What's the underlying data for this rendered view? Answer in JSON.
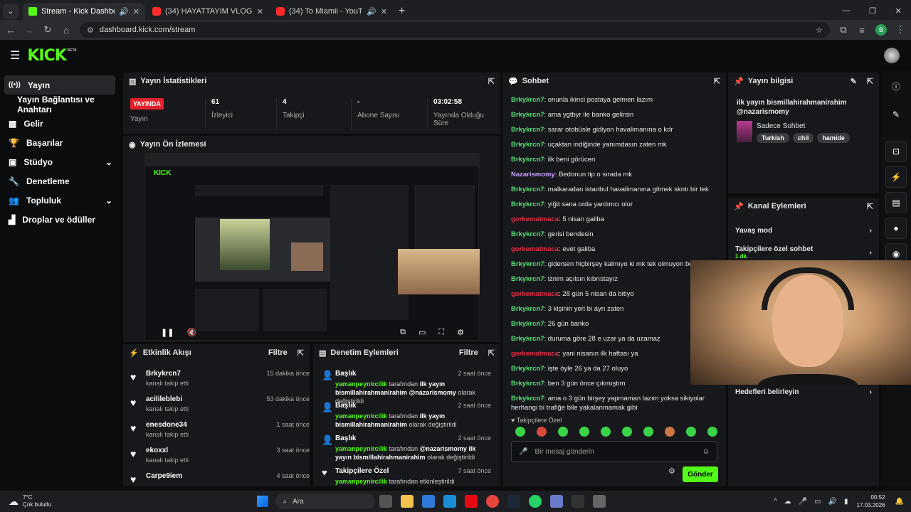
{
  "tabs": [
    {
      "title": "Stream - Kick Dashboard",
      "fav": "#53fc18"
    },
    {
      "title": "(34) HAYATTAYIM VLOG - YouTu",
      "fav": "#ff2a2a"
    },
    {
      "title": "(34) To Miamii - YouTube",
      "fav": "#ff2a2a"
    }
  ],
  "address": {
    "url": "dashboard.kick.com/stream",
    "profile": "B"
  },
  "brand": {
    "logo": "KICK",
    "beta": "BETA"
  },
  "sidebar": [
    {
      "label": "Yayın",
      "icon": "broadcast-icon"
    },
    {
      "label": "Yayın Bağlantısı ve Anahtarı",
      "icon": ""
    },
    {
      "label": "Gelir",
      "icon": "revenue-icon"
    },
    {
      "label": "Başarılar",
      "icon": "trophy-icon"
    },
    {
      "label": "Stüdyo",
      "icon": "studio-icon"
    },
    {
      "label": "Denetleme",
      "icon": "wrench-icon"
    },
    {
      "label": "Topluluk",
      "icon": "community-icon"
    },
    {
      "label": "Droplar ve ödüller",
      "icon": "drops-icon"
    }
  ],
  "stats": {
    "title": "Yayın İstatistikleri",
    "live": "YAYINDA",
    "status_label": "Yayın",
    "viewers": "61",
    "viewers_label": "İzleyici",
    "followers": "4",
    "followers_label": "Takipçi",
    "subs": "-",
    "subs_label": "Abone Sayısı",
    "duration": "03:02:58",
    "duration_label": "Yayında Olduğu Süre"
  },
  "preview": {
    "title": "Yayın Ön İzlemesi"
  },
  "activity": {
    "title": "Etkinlik Akışı",
    "filter": "Filtre",
    "items": [
      {
        "name": "Brkykrcn7",
        "sub": "kanalı takip etti",
        "time": "15 dakika önce"
      },
      {
        "name": "acilileblebi",
        "sub": "kanalı takip etti",
        "time": "53 dakika önce"
      },
      {
        "name": "enesdone34",
        "sub": "kanalı takip etti",
        "time": "1 saat önce"
      },
      {
        "name": "ekoxxl",
        "sub": "kanalı takip etti",
        "time": "3 saat önce"
      },
      {
        "name": "Carpe9iem",
        "sub": "",
        "time": "4 saat önce"
      }
    ]
  },
  "moderation": {
    "title": "Denetim Eylemleri",
    "filter": "Filtre",
    "items": [
      {
        "name": "Başlık",
        "time": "2 saat önce",
        "user": "yamanpeynircilik",
        "by": "tarafından",
        "text": "ilk yayın bismillahirahmanirahim @nazarismomy",
        "end": "olarak değiştirildi"
      },
      {
        "name": "Başlık",
        "time": "2 saat önce",
        "user": "yamanpeynircilik",
        "by": "tarafından",
        "text": "ilk yayın bismillahirahmanirahim",
        "end": "olarak değiştirildi"
      },
      {
        "name": "Başlık",
        "time": "2 saat önce",
        "user": "yamanpeynircilik",
        "by": "tarafından",
        "text": "@nazarismomy ilk yayın bismillahirahmanirahim",
        "end": "olarak değiştirildi"
      },
      {
        "name": "Takipçilere Özel",
        "time": "7 saat önce",
        "user": "yamanpeynircilik",
        "by": "tarafından etkinleştirildi",
        "text": "",
        "end": ""
      }
    ]
  },
  "chat": {
    "title": "Sohbet",
    "messages": [
      {
        "u": "Brkykrcn7",
        "c": "#5be07a",
        "m": "onunla ikinci postaya gelmen lazım"
      },
      {
        "u": "Brkykrcn7",
        "c": "#5be07a",
        "m": "ama ygtbyr ile banko gelirsin"
      },
      {
        "u": "Brkykrcn7",
        "c": "#5be07a",
        "m": "sarar otobüsle gidiyon havalimanına o kdr"
      },
      {
        "u": "Brkykrcn7",
        "c": "#5be07a",
        "m": "uçaktan indiğinde yanımdasın zaten mk"
      },
      {
        "u": "Brkykrcn7",
        "c": "#5be07a",
        "m": "ilk beni görücen"
      },
      {
        "u": "Nazarismomy",
        "c": "#c9a0ff",
        "m": "Bedonun tip o sırada mk"
      },
      {
        "u": "Brkykrcn7",
        "c": "#5be07a",
        "m": "malkaradan istanbul havalimanına gitmek skntı bir tek"
      },
      {
        "u": "Brkykrcn7",
        "c": "#5be07a",
        "m": "yiğit sana orda yardımcı olur"
      },
      {
        "u": "gorkematmaca",
        "c": "#e0304a",
        "m": "5 nisan galiba"
      },
      {
        "u": "Brkykrcn7",
        "c": "#5be07a",
        "m": "gerisi bendesin"
      },
      {
        "u": "gorkematmaca",
        "c": "#e0304a",
        "m": "evet galiba"
      },
      {
        "u": "Brkykrcn7",
        "c": "#5be07a",
        "m": "gidersen hiçbirşey kalmıyo ki mk tek olmuyon ben de"
      },
      {
        "u": "Brkykrcn7",
        "c": "#5be07a",
        "m": "iznim açılsın kıbrıstayız"
      },
      {
        "u": "gorkematmaca",
        "c": "#e0304a",
        "m": "28 gün 5 nisan da bitiyo"
      },
      {
        "u": "Brkykrcn7",
        "c": "#5be07a",
        "m": "3 kişinin yeri bi ayrı zaten"
      },
      {
        "u": "Brkykrcn7",
        "c": "#5be07a",
        "m": "26 gün banko"
      },
      {
        "u": "Brkykrcn7",
        "c": "#5be07a",
        "m": "duruma göre 28 e uzar ya da uzamaz"
      },
      {
        "u": "gorkematmaca",
        "c": "#e0304a",
        "m": "yani nisanın ilk haftası ya"
      },
      {
        "u": "Brkykrcn7",
        "c": "#5be07a",
        "m": "işte öyle 26 ya da 27 oluyo"
      },
      {
        "u": "Brkykrcn7",
        "c": "#5be07a",
        "m": "ben 3 gün önce çıkmıştım"
      },
      {
        "u": "Brkykrcn7",
        "c": "#5be07a",
        "m": "ama o 3 gün birşey yapmaman lazım yoksa sikiyolar herhangi bi trafiğe bile yakalanmamak gibi"
      }
    ],
    "followers_only": "Takipçilere Özel",
    "placeholder": "Bir mesaj gönderin",
    "send": "Gönder"
  },
  "info": {
    "title": "Yayın bilgisi",
    "stream_title": "ilk yayın bismillahirahmanirahim @nazarismomy",
    "category": "Sadece Sohbet",
    "tags": [
      "Turkish",
      "chil",
      "hamide"
    ]
  },
  "channel_actions": {
    "title": "Kanal Eylemleri",
    "items": [
      {
        "label": "Yavaş mod",
        "sub": ""
      },
      {
        "label": "Takipçilere özel sohbet",
        "sub": "1 dk."
      }
    ],
    "goals": "Hedefleri belirleyin"
  },
  "taskbar": {
    "weather_temp": "7°C",
    "weather_text": "Çok bulutlu",
    "search": "Ara",
    "time": "00:52",
    "date": "17.03.2026"
  }
}
